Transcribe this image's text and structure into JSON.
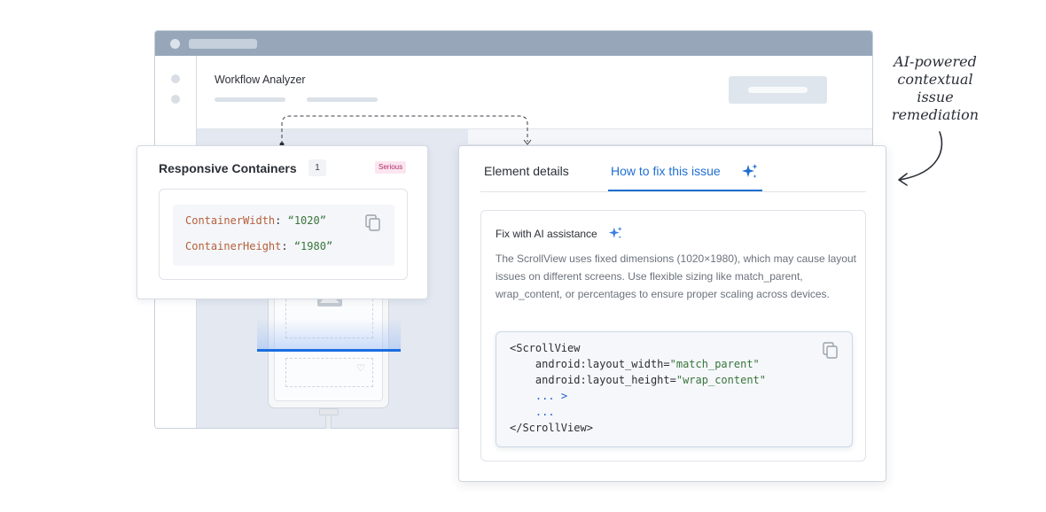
{
  "app": {
    "title": "Workflow Analyzer"
  },
  "issue_card": {
    "title": "Responsive Containers",
    "count": "1",
    "severity": "Serious",
    "code": [
      {
        "key": "ContainerWidth",
        "sep": ": ",
        "value": "“1020”"
      },
      {
        "key": "ContainerHeight",
        "sep": ": ",
        "value": "“1980”"
      }
    ]
  },
  "details_panel": {
    "tabs": [
      {
        "label": "Element details",
        "active": false
      },
      {
        "label": "How to fix this issue",
        "active": true
      }
    ],
    "ai_section": {
      "title": "Fix with AI assistance",
      "description": "The ScrollView uses fixed dimensions (1020×1980), which may cause layout issues on different screens. Use flexible sizing like match_parent, wrap_content, or percentages to ensure proper scaling across devices."
    },
    "xml_code": {
      "open_tag": "<ScrollView",
      "attr1_name": "android:layout_width=",
      "attr1_value": "\"match_parent\"",
      "attr2_name": "android:layout_height=",
      "attr2_value": "\"wrap_content\"",
      "ellipsis1": "... ",
      "ellipsis1_close": ">",
      "ellipsis2": "...",
      "close_tag": "</ScrollView>"
    }
  },
  "annotation": {
    "line1": "AI-powered",
    "line2": "contextual",
    "line3": "issue",
    "line4": "remediation"
  },
  "colors": {
    "accent": "#1f6fd1",
    "severity_bg": "#fbe6ef",
    "severity_text": "#b02a6a",
    "scan_line": "#1b6de0"
  },
  "icons": [
    "copy-icon",
    "sparkle-icon",
    "image-icon",
    "heart-icon",
    "arrow-icon"
  ]
}
